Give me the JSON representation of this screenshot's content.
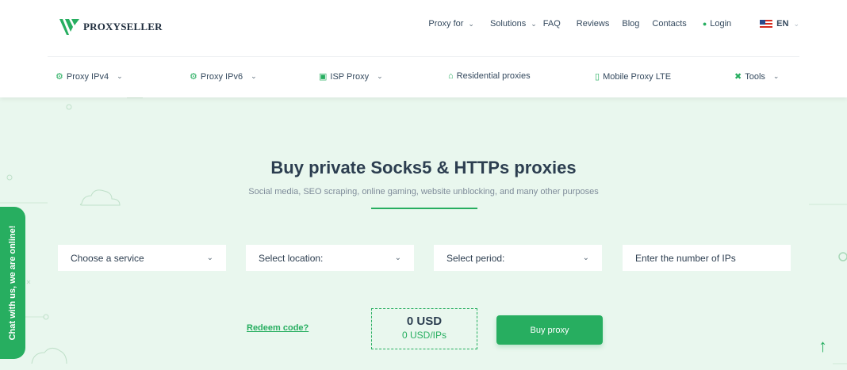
{
  "header": {
    "logo_text": "PROXYSELLER",
    "top_nav": [
      {
        "label": "Proxy for",
        "has_dropdown": true
      },
      {
        "label": "Solutions",
        "has_dropdown": true
      },
      {
        "label": "FAQ",
        "has_dropdown": false
      },
      {
        "label": "Reviews",
        "has_dropdown": false
      },
      {
        "label": "Blog",
        "has_dropdown": false
      },
      {
        "label": "Contacts",
        "has_dropdown": false
      }
    ],
    "login_label": "Login",
    "language": "EN",
    "sub_nav": [
      {
        "label": "Proxy IPv4",
        "icon": "globe-icon"
      },
      {
        "label": "Proxy IPv6",
        "icon": "globe-icon"
      },
      {
        "label": "ISP Proxy",
        "icon": "monitor-icon"
      },
      {
        "label": "Residential proxies",
        "icon": "home-icon"
      },
      {
        "label": "Mobile Proxy LTE",
        "icon": "mobile-icon"
      },
      {
        "label": "Tools",
        "icon": "tools-icon"
      }
    ]
  },
  "hero": {
    "title": "Buy private Socks5 & HTTPs proxies",
    "subtitle": "Social media, SEO scraping, online gaming, website unblocking, and many other purposes"
  },
  "form": {
    "service": "Choose a service",
    "location": "Select location:",
    "period": "Select period:",
    "ip_count_placeholder": "Enter the number of IPs"
  },
  "order": {
    "redeem_label": "Redeem code?",
    "price": "0 USD",
    "price_per_ip": "0 USD/IPs",
    "buy_label": "Buy proxy"
  },
  "chat": {
    "label": "Chat with us, we are online!"
  },
  "colors": {
    "accent": "#27ae60",
    "background": "#e9f7ee",
    "text": "#2d3e50"
  }
}
